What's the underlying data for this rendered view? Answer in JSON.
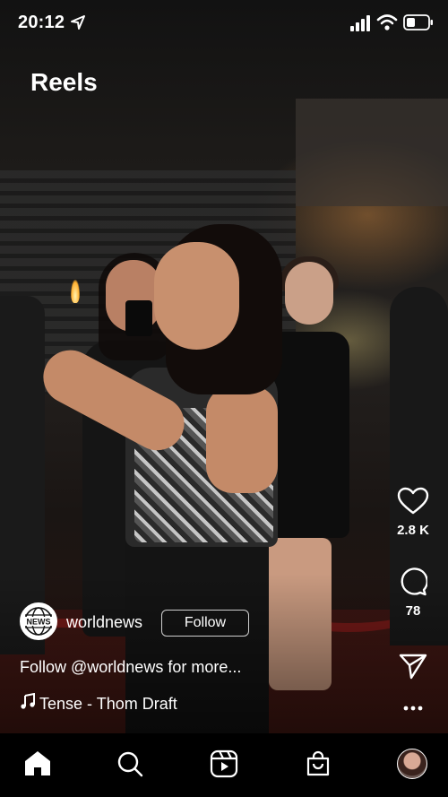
{
  "status_bar": {
    "time": "20:12"
  },
  "header": {
    "title": "Reels"
  },
  "post": {
    "username": "worldnews",
    "avatar_text": "NEWS",
    "follow_label": "Follow",
    "caption": "Follow @worldnews for more...",
    "music": "Tense - Thom Draft",
    "likes": "2.8 K",
    "comments": "78"
  },
  "icons": {
    "status": [
      "location-arrow-icon",
      "signal-icon",
      "wifi-icon",
      "battery-icon"
    ],
    "actions": [
      "heart-icon",
      "comment-icon",
      "send-icon",
      "more-icon"
    ],
    "nav": [
      "home-icon",
      "search-icon",
      "reels-icon",
      "shop-icon",
      "profile-avatar"
    ]
  },
  "colors": {
    "background": "#000000",
    "text": "#ffffff"
  }
}
